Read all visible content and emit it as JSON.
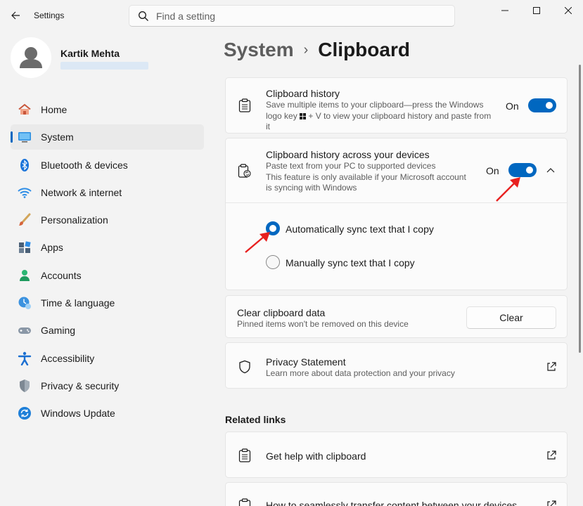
{
  "window": {
    "title": "Settings"
  },
  "search": {
    "placeholder": "Find a setting"
  },
  "user": {
    "name": "Kartik Mehta"
  },
  "nav": {
    "items": [
      {
        "label": "Home",
        "icon": "home-icon"
      },
      {
        "label": "System",
        "icon": "system-icon",
        "active": true
      },
      {
        "label": "Bluetooth & devices",
        "icon": "bluetooth-icon"
      },
      {
        "label": "Network & internet",
        "icon": "network-icon"
      },
      {
        "label": "Personalization",
        "icon": "brush-icon"
      },
      {
        "label": "Apps",
        "icon": "apps-icon"
      },
      {
        "label": "Accounts",
        "icon": "accounts-icon"
      },
      {
        "label": "Time & language",
        "icon": "time-language-icon"
      },
      {
        "label": "Gaming",
        "icon": "gaming-icon"
      },
      {
        "label": "Accessibility",
        "icon": "accessibility-icon"
      },
      {
        "label": "Privacy & security",
        "icon": "shield-icon"
      },
      {
        "label": "Windows Update",
        "icon": "update-icon"
      }
    ]
  },
  "breadcrumb": {
    "parent": "System",
    "separator": "›",
    "current": "Clipboard"
  },
  "clipboard_history": {
    "title": "Clipboard history",
    "desc_line1": "Save multiple items to your clipboard—press the Windows",
    "desc_line2_a": "logo key",
    "desc_line2_b": "+ V to view your clipboard history and paste from",
    "desc_line3": "it",
    "toggle_label": "On",
    "toggle_on": true
  },
  "cross_device": {
    "title": "Clipboard history across your devices",
    "desc_line1": "Paste text from your PC to supported devices",
    "desc_line2": "This feature is only available if your Microsoft account",
    "desc_line3": "is syncing with Windows",
    "toggle_label": "On",
    "toggle_on": true,
    "options": [
      {
        "label": "Automatically sync text that I copy",
        "selected": true
      },
      {
        "label": "Manually sync text that I copy",
        "selected": false
      }
    ]
  },
  "clear_data": {
    "title": "Clear clipboard data",
    "desc": "Pinned items won't be removed on this device",
    "button_label": "Clear"
  },
  "privacy": {
    "title": "Privacy Statement",
    "desc": "Learn more about data protection and your privacy"
  },
  "related_links": {
    "heading": "Related links",
    "items": [
      {
        "label": "Get help with clipboard"
      },
      {
        "label": "How to seamlessly transfer content between your devices"
      }
    ]
  },
  "colors": {
    "accent": "#0067c0",
    "annotation_arrow": "#e8201f"
  }
}
